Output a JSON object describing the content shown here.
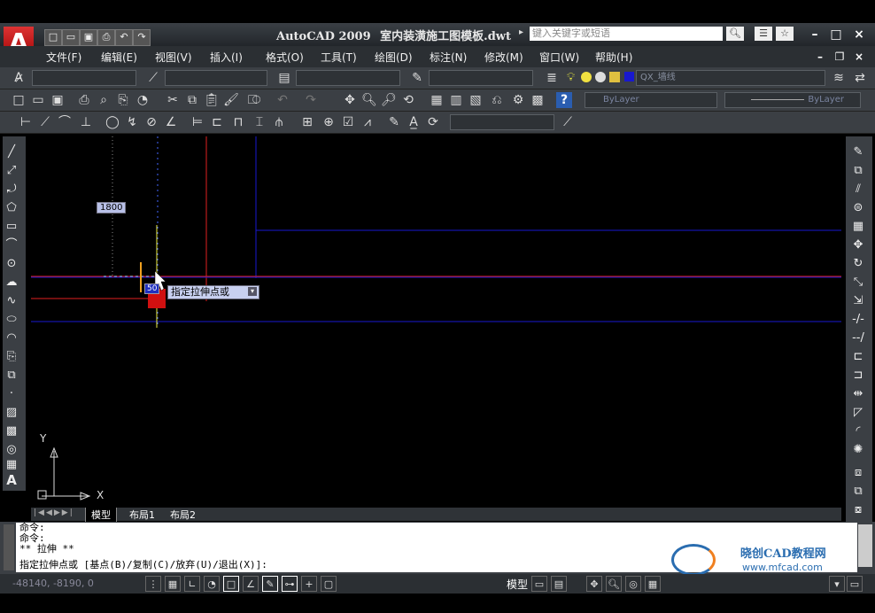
{
  "app": {
    "title": "AutoCAD 2009",
    "filename": "室内装潢施工图模板.dwt",
    "search_placeholder": "键入关键字或短语"
  },
  "menu": [
    "文件(F)",
    "编辑(E)",
    "视图(V)",
    "插入(I)",
    "格式(O)",
    "工具(T)",
    "绘图(D)",
    "标注(N)",
    "修改(M)",
    "窗口(W)",
    "帮助(H)"
  ],
  "toolbars": {
    "layer_name": "QX_墙线",
    "color_value": "ByLayer",
    "linetype_value": "ByLayer"
  },
  "drawing": {
    "dim_label": "1800",
    "dyn_input_value": "50",
    "grip_tooltip": "指定拉伸点或",
    "axis_x": "X",
    "axis_y": "Y"
  },
  "tabs": [
    "模型",
    "布局1",
    "布局2"
  ],
  "command": {
    "lines": [
      "命令:",
      "命令:",
      "** 拉伸 **"
    ],
    "prompt": "指定拉伸点或 [基点(B)/复制(C)/放弃(U)/退出(X)]:"
  },
  "status": {
    "coords": "-48140, -8190, 0",
    "model_label": "模型"
  },
  "watermark": {
    "name": "晓创CAD教程网",
    "url": "www.mfcad.com"
  },
  "colors": {
    "blue_line": "#1818d0",
    "red_line": "#e02020",
    "orange": "#f0a020",
    "yellow": "#f0f040"
  }
}
